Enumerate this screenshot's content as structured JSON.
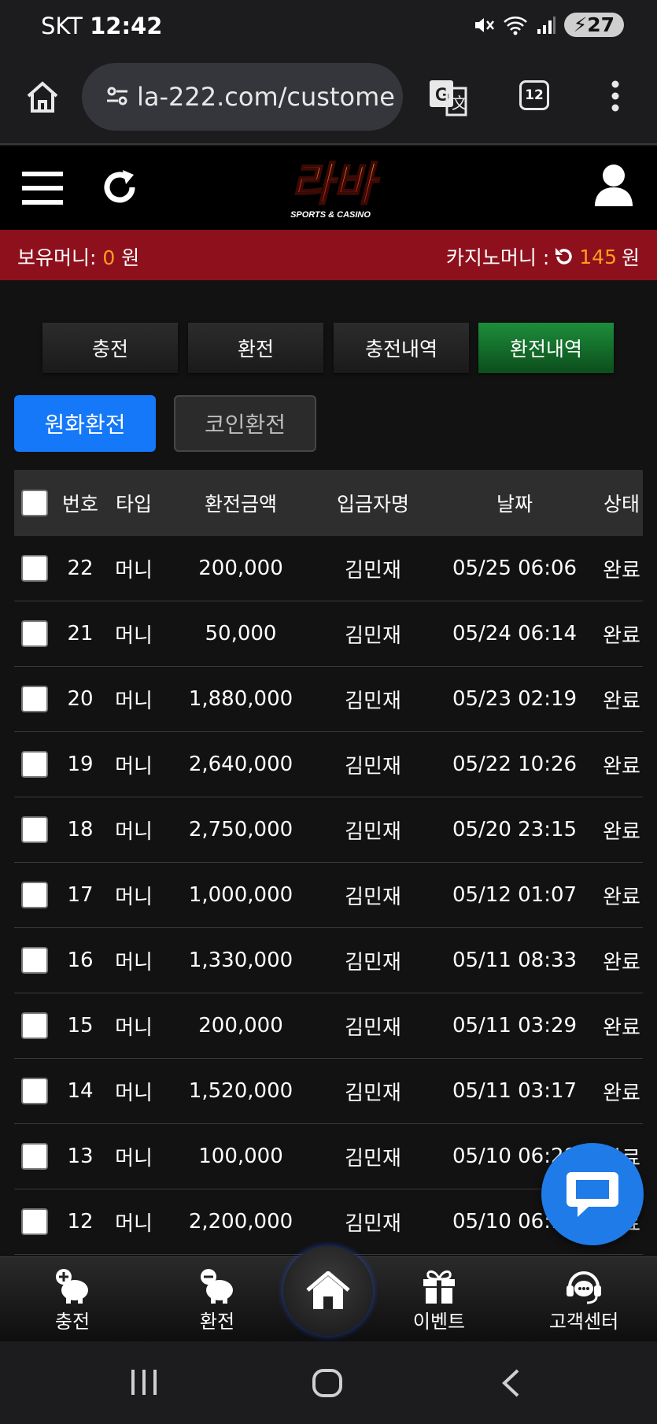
{
  "status_bar": {
    "carrier": "SKT",
    "time": "12:42",
    "battery": "27"
  },
  "browser": {
    "url": "la-222.com/custome",
    "tab_count": "12"
  },
  "site": {
    "logo_text": "라바",
    "logo_subtitle": "SPORTS & CASINO"
  },
  "money_bar": {
    "holding_label": "보유머니:",
    "holding_value": "0",
    "holding_unit": "원",
    "casino_label": "카지노머니 :",
    "casino_value": "145",
    "casino_unit": "원"
  },
  "tabs": [
    {
      "label": "충전"
    },
    {
      "label": "환전"
    },
    {
      "label": "충전내역"
    },
    {
      "label": "환전내역",
      "active": true
    }
  ],
  "subtabs": [
    {
      "label": "원화환전",
      "active": true
    },
    {
      "label": "코인환전"
    }
  ],
  "table": {
    "headers": {
      "no": "번호",
      "type": "타입",
      "amount": "환전금액",
      "name": "입금자명",
      "date": "날짜",
      "status": "상태"
    },
    "rows": [
      {
        "no": "22",
        "type": "머니",
        "amount": "200,000",
        "name": "김민재",
        "date": "05/25 06:06",
        "status": "완료"
      },
      {
        "no": "21",
        "type": "머니",
        "amount": "50,000",
        "name": "김민재",
        "date": "05/24 06:14",
        "status": "완료"
      },
      {
        "no": "20",
        "type": "머니",
        "amount": "1,880,000",
        "name": "김민재",
        "date": "05/23 02:19",
        "status": "완료"
      },
      {
        "no": "19",
        "type": "머니",
        "amount": "2,640,000",
        "name": "김민재",
        "date": "05/22 10:26",
        "status": "완료"
      },
      {
        "no": "18",
        "type": "머니",
        "amount": "2,750,000",
        "name": "김민재",
        "date": "05/20 23:15",
        "status": "완료"
      },
      {
        "no": "17",
        "type": "머니",
        "amount": "1,000,000",
        "name": "김민재",
        "date": "05/12 01:07",
        "status": "완료"
      },
      {
        "no": "16",
        "type": "머니",
        "amount": "1,330,000",
        "name": "김민재",
        "date": "05/11 08:33",
        "status": "완료"
      },
      {
        "no": "15",
        "type": "머니",
        "amount": "200,000",
        "name": "김민재",
        "date": "05/11 03:29",
        "status": "완료"
      },
      {
        "no": "14",
        "type": "머니",
        "amount": "1,520,000",
        "name": "김민재",
        "date": "05/11 03:17",
        "status": "완료"
      },
      {
        "no": "13",
        "type": "머니",
        "amount": "100,000",
        "name": "김민재",
        "date": "05/10 06:28",
        "status": "완료"
      },
      {
        "no": "12",
        "type": "머니",
        "amount": "2,200,000",
        "name": "김민재",
        "date": "05/10 06:13",
        "status": "완료"
      }
    ]
  },
  "bottom_nav": {
    "deposit": "충전",
    "withdraw": "환전",
    "event": "이벤트",
    "support": "고객센터"
  },
  "colors": {
    "money_bar": "#8e101d",
    "active_tab": "#1d8d3a",
    "primary_button": "#1478f8",
    "accent_value": "#ff9d1e",
    "chat_bubble": "#1f7be8"
  },
  "icons": [
    "home-icon",
    "url-settings-icon",
    "translate-icon",
    "tabs-icon",
    "more-menu-icon",
    "hamburger-menu-icon",
    "reload-icon",
    "user-icon",
    "refresh-icon",
    "chat-icon",
    "deposit-pig-icon",
    "withdraw-pig-icon",
    "gift-icon",
    "support-headset-icon"
  ]
}
